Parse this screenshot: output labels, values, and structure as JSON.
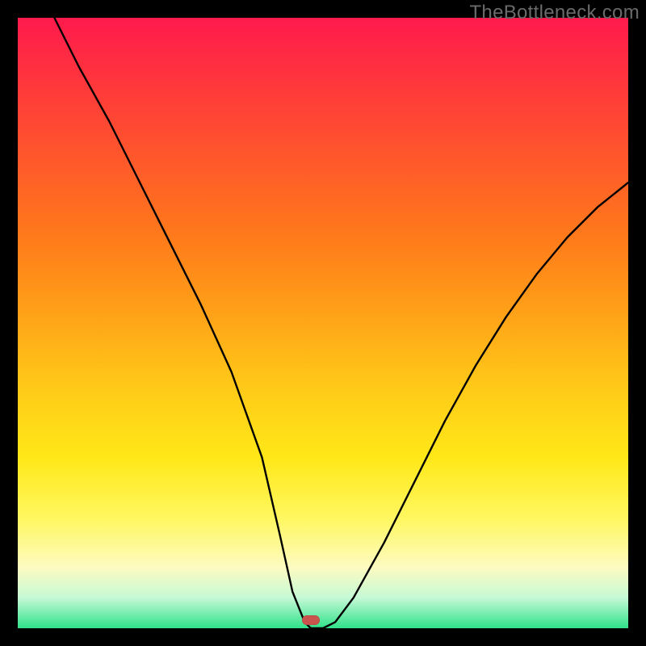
{
  "watermark": "TheBottleneck.com",
  "marker": {
    "left_pct": 48.0,
    "bottom_pct": 1.3
  },
  "chart_data": {
    "type": "line",
    "title": "",
    "xlabel": "",
    "ylabel": "",
    "xlim": [
      0,
      100
    ],
    "ylim": [
      0,
      100
    ],
    "grid": false,
    "legend": false,
    "x": [
      6,
      10,
      15,
      20,
      25,
      30,
      35,
      40,
      43,
      45,
      47,
      48,
      50,
      52,
      55,
      60,
      65,
      70,
      75,
      80,
      85,
      90,
      95,
      100
    ],
    "values": [
      100,
      92,
      83,
      73,
      63,
      53,
      42,
      28,
      15,
      6,
      1,
      0,
      0,
      1,
      5,
      14,
      24,
      34,
      43,
      51,
      58,
      64,
      69,
      73
    ],
    "annotations": [
      {
        "type": "marker",
        "x": 48,
        "y": 0,
        "shape": "pill",
        "color": "#c9544e"
      }
    ],
    "background_gradient": {
      "axis": "y",
      "stops": [
        {
          "pos": 0,
          "color": "#2fe28a"
        },
        {
          "pos": 5,
          "color": "#c6f9d6"
        },
        {
          "pos": 10,
          "color": "#fdfbc0"
        },
        {
          "pos": 18,
          "color": "#fff760"
        },
        {
          "pos": 28,
          "color": "#ffe818"
        },
        {
          "pos": 40,
          "color": "#ffc818"
        },
        {
          "pos": 52,
          "color": "#ffa018"
        },
        {
          "pos": 64,
          "color": "#ff7a1a"
        },
        {
          "pos": 76,
          "color": "#ff5a2a"
        },
        {
          "pos": 88,
          "color": "#ff3a3a"
        },
        {
          "pos": 100,
          "color": "#ff1a4d"
        }
      ]
    }
  }
}
